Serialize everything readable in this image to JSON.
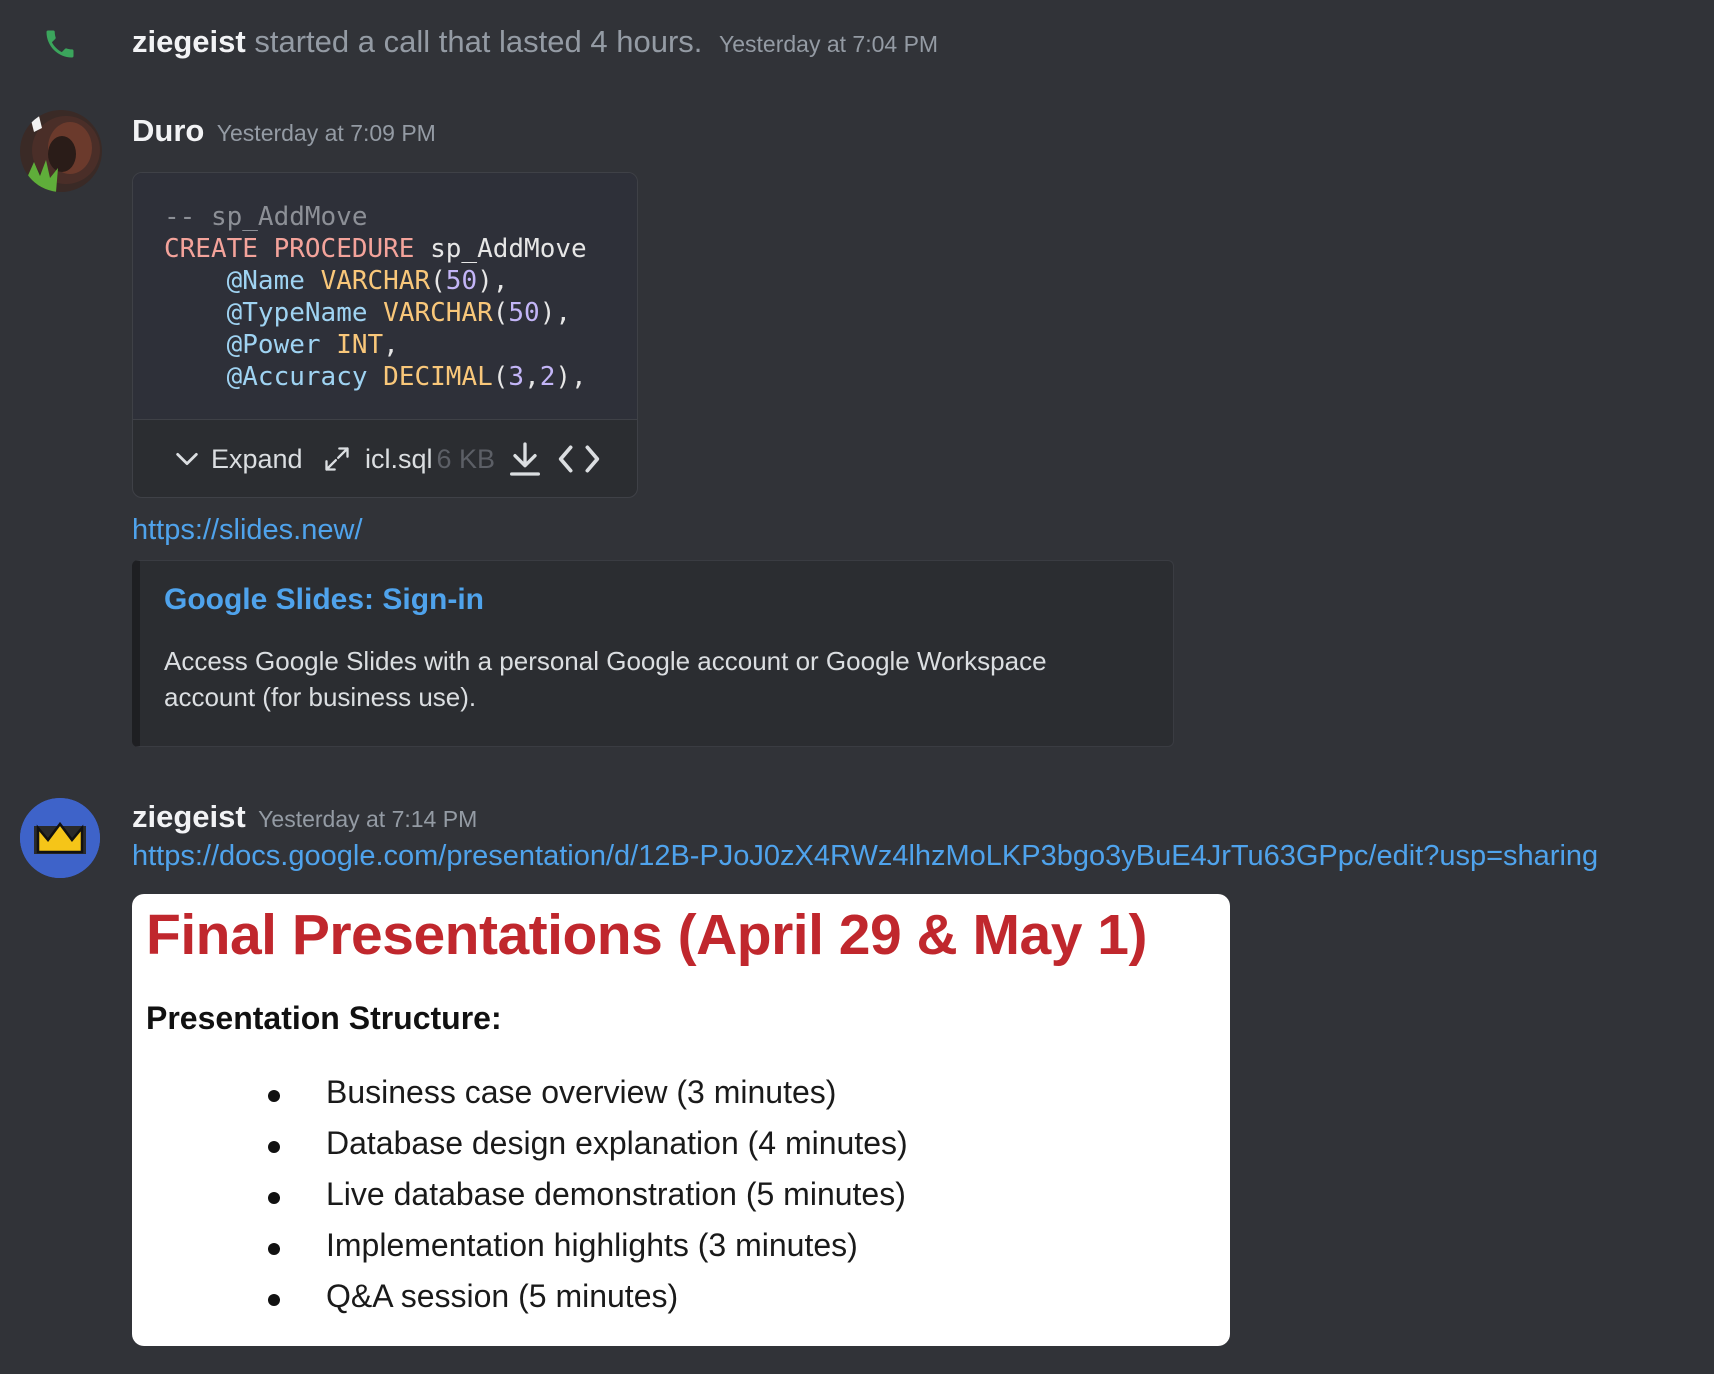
{
  "call": {
    "user": "ziegeist",
    "text": "started a call that lasted 4 hours.",
    "timestamp": "Yesterday at 7:04 PM"
  },
  "messages": [
    {
      "author": "Duro",
      "timestamp": "Yesterday at 7:09 PM",
      "code_attachment": {
        "lines": [
          "-- sp_AddMove",
          "CREATE PROCEDURE sp_AddMove",
          "    @Name VARCHAR(50),",
          "    @TypeName VARCHAR(50),",
          "    @Power INT,",
          "    @Accuracy DECIMAL(3,2),"
        ],
        "expand_label": "Expand",
        "file_name": "icl.sql",
        "file_size": "6 KB"
      },
      "link": "https://slides.new/",
      "embed": {
        "title": "Google Slides: Sign-in",
        "description": "Access Google Slides with a personal Google account or Google Workspace account (for business use)."
      }
    },
    {
      "author": "ziegeist",
      "timestamp": "Yesterday at 7:14 PM",
      "link": "https://docs.google.com/presentation/d/12B-PJoJ0zX4RWz4lhzMoLKP3bgo3yBuE4JrTu63GPpc/edit?usp=sharing",
      "image": {
        "title": "Final Presentations (April 29 & May 1)",
        "subtitle": "Presentation Structure:",
        "bullets": [
          "Business case overview (3 minutes)",
          "Database design explanation (4 minutes)",
          "Live database demonstration (5 minutes)",
          "Implementation highlights (3 minutes)",
          "Q&A session (5 minutes)"
        ]
      }
    }
  ],
  "colors": {
    "background": "#313338",
    "link": "#4fa3ec",
    "call_icon": "#3ba55c",
    "slide_title": "#c0272d"
  }
}
